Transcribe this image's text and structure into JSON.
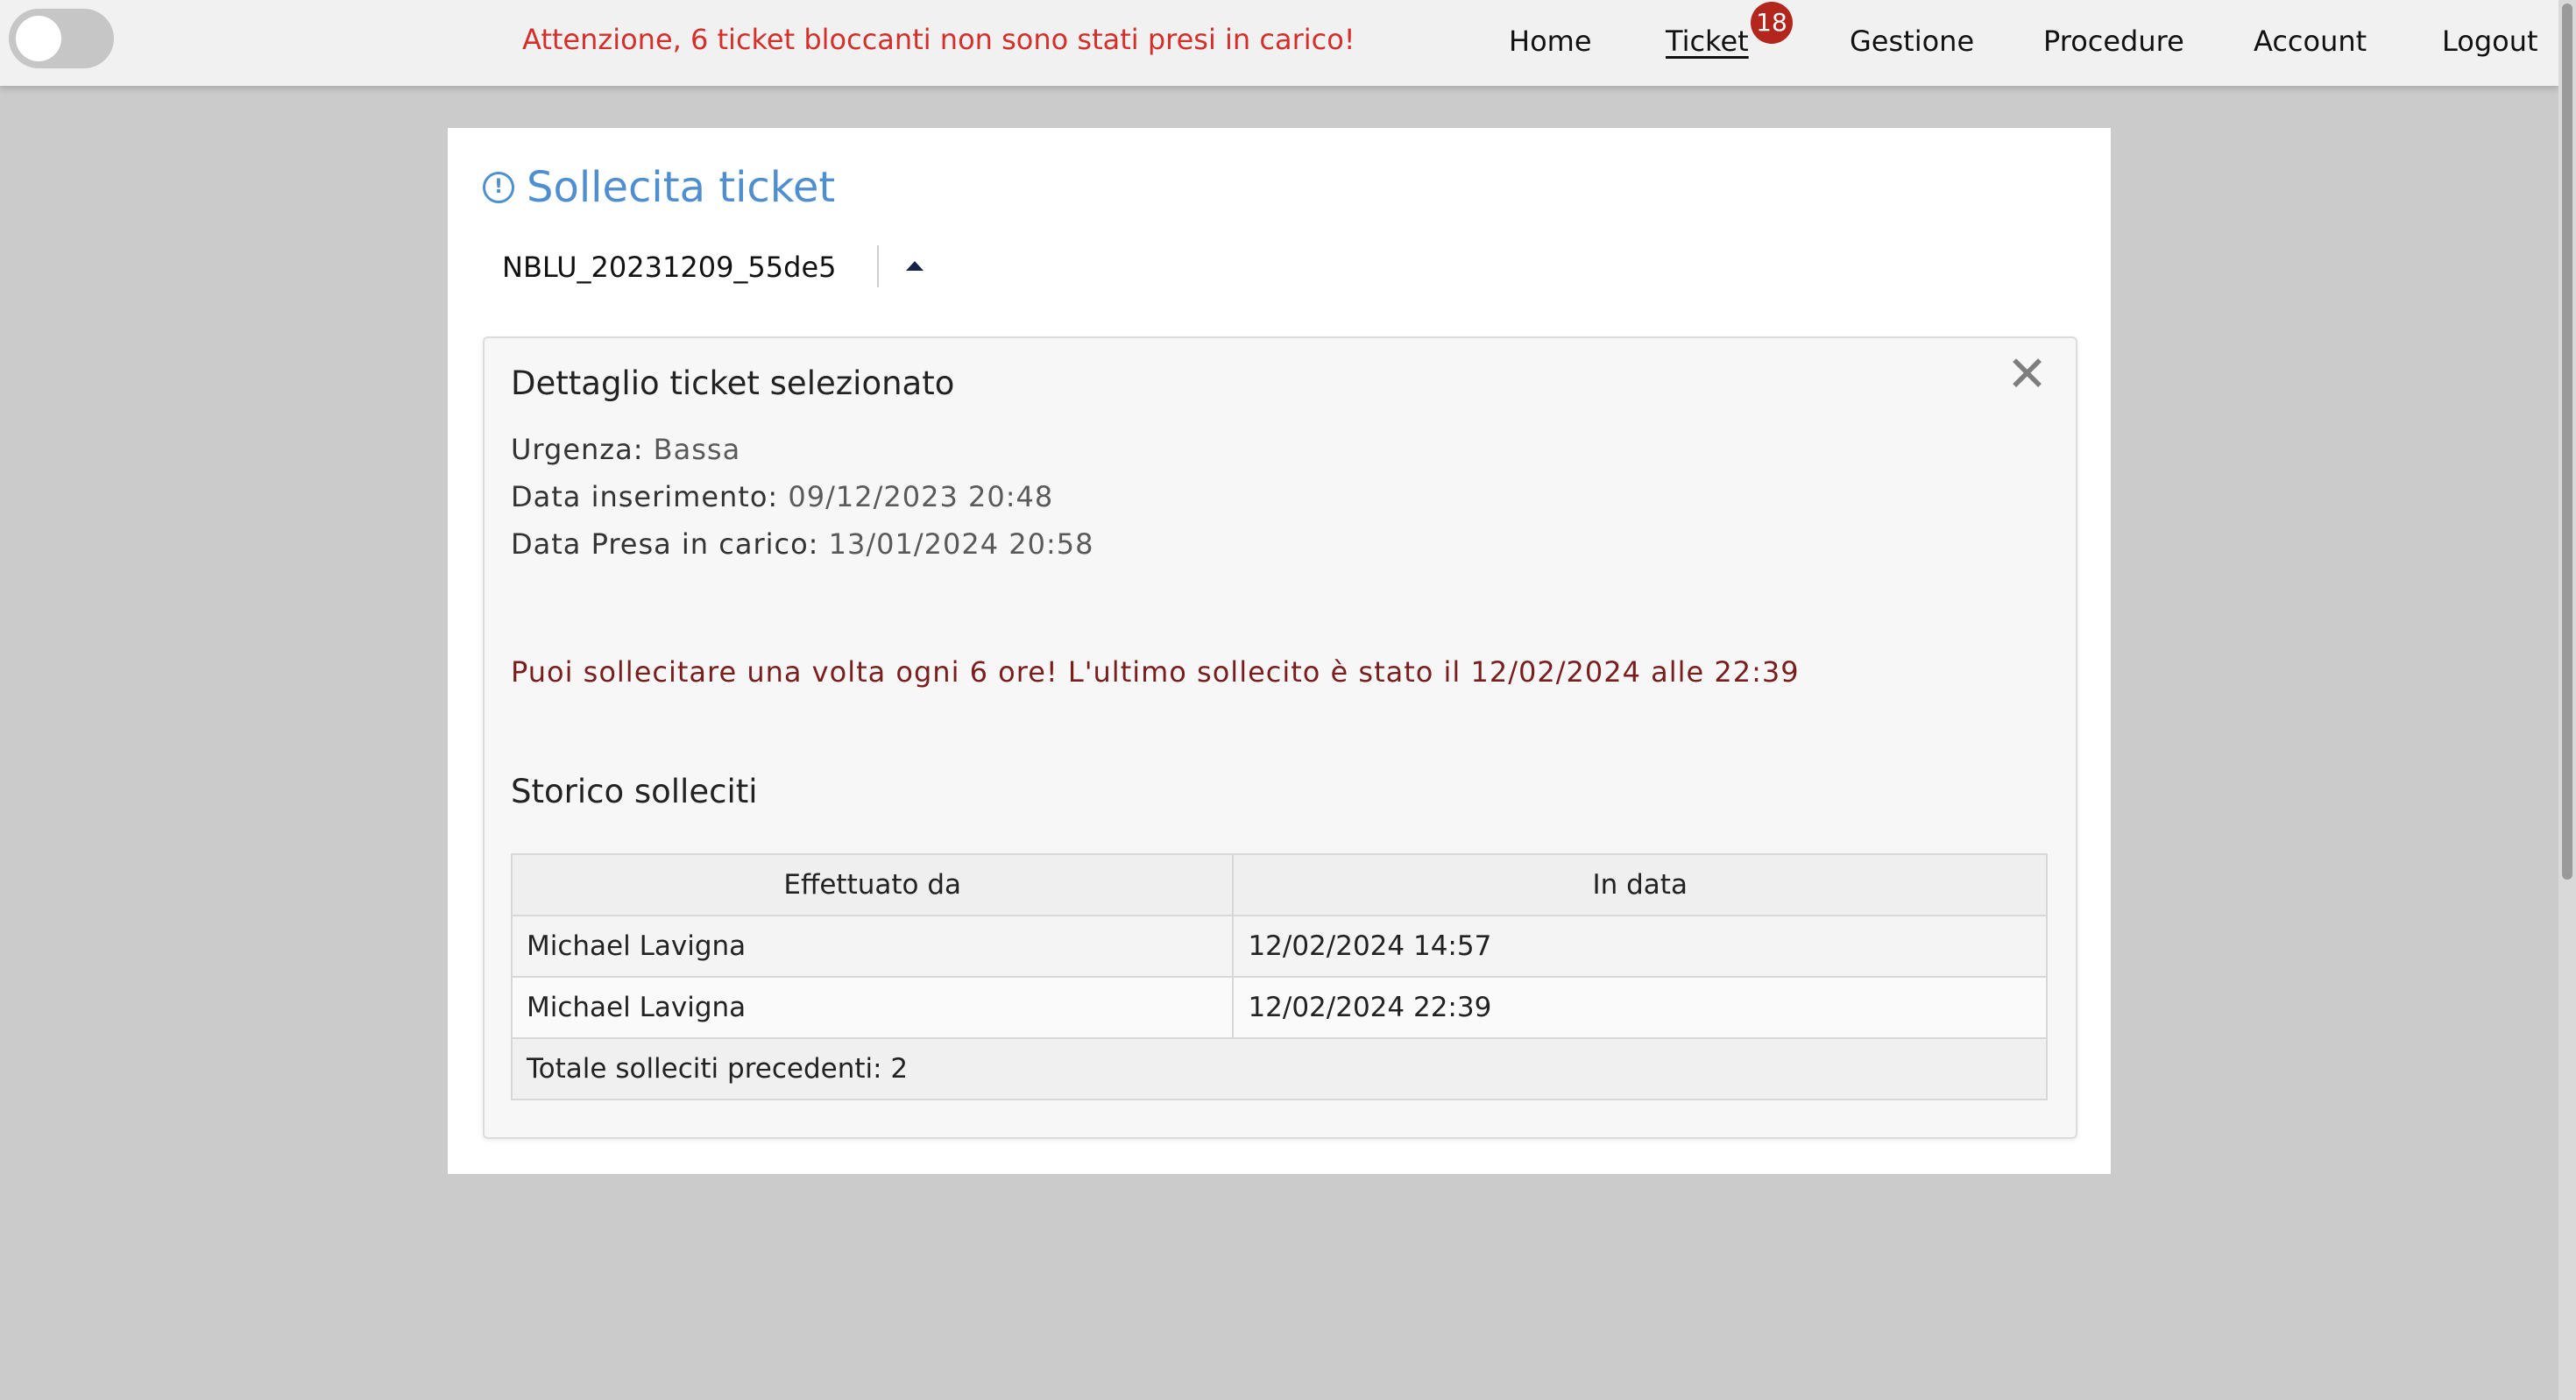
{
  "topbar": {
    "alert": "Attenzione, 6 ticket bloccanti non sono stati presi in carico!",
    "nav": {
      "home": "Home",
      "ticket": "Ticket",
      "ticket_badge": "18",
      "gestione": "Gestione",
      "procedure": "Procedure",
      "account": "Account",
      "logout": "Logout"
    },
    "toggle_state": "off"
  },
  "page": {
    "title": "Sollecita ticket",
    "title_icon": "exclamation-circle-icon",
    "selected_ticket": "NBLU_20231209_55de5"
  },
  "detail": {
    "title": "Dettaglio ticket selezionato",
    "urgency_label": "Urgenza:",
    "urgency_value": "Bassa",
    "inserted_label": "Data inserimento:",
    "inserted_value": "09/12/2023 20:48",
    "taken_label": "Data Presa in carico:",
    "taken_value": "13/01/2024 20:58",
    "warning": "Puoi sollecitare una volta ogni 6 ore! L'ultimo sollecito è stato il 12/02/2024 alle 22:39"
  },
  "history": {
    "title": "Storico solleciti",
    "columns": [
      "Effettuato da",
      "In data"
    ],
    "rows": [
      [
        "Michael Lavigna",
        "12/02/2024 14:57"
      ],
      [
        "Michael Lavigna",
        "12/02/2024 22:39"
      ]
    ],
    "total": "Totale solleciti precedenti: 2"
  },
  "colors": {
    "alert_red": "#d62f2a",
    "title_blue": "#4f8fd0",
    "badge_red": "#b3261e",
    "warning_dark_red": "#7a1d1d"
  }
}
